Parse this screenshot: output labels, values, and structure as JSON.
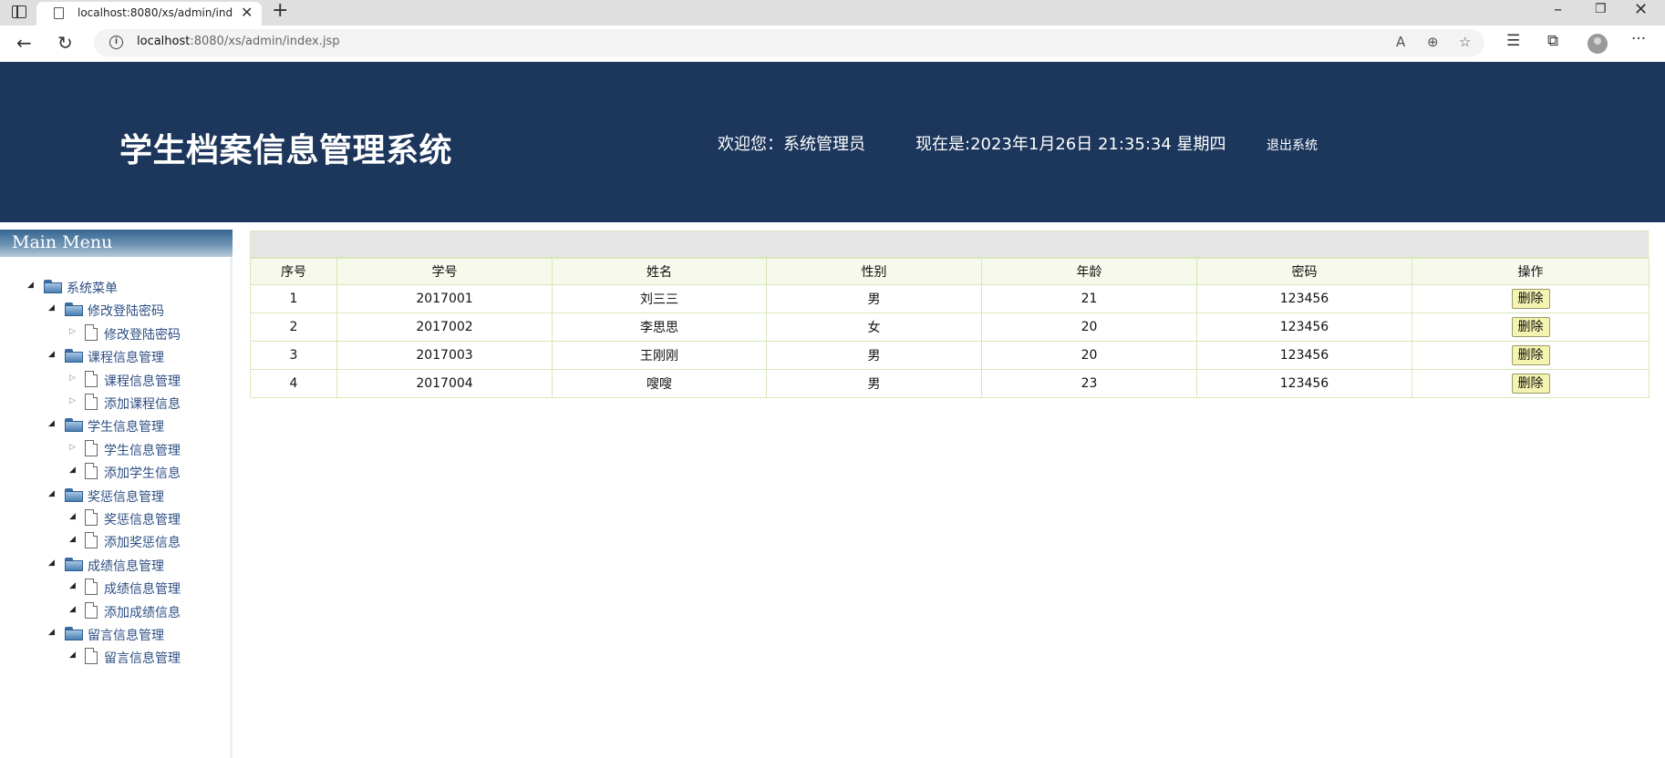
{
  "browser": {
    "tab_title": "localhost:8080/xs/admin/index.jsp",
    "url_host": "localhost",
    "url_rest": ":8080/xs/admin/index.jsp"
  },
  "header": {
    "title": "学生档案信息管理系统",
    "welcome": "欢迎您：系统管理员",
    "clock": "现在是:2023年1月26日 21:35:34 星期四",
    "logout": "退出系统",
    "background": "#1c365c"
  },
  "sidebar": {
    "title": "Main Menu",
    "items": [
      {
        "label": "系统菜单",
        "level": 0,
        "type": "folder",
        "arrow": "open"
      },
      {
        "label": "修改登陆密码",
        "level": 1,
        "type": "folder",
        "arrow": "open"
      },
      {
        "label": "修改登陆密码",
        "level": 2,
        "type": "file",
        "arrow": "closed"
      },
      {
        "label": "课程信息管理",
        "level": 1,
        "type": "folder",
        "arrow": "open"
      },
      {
        "label": "课程信息管理",
        "level": 2,
        "type": "file",
        "arrow": "closed"
      },
      {
        "label": "添加课程信息",
        "level": 2,
        "type": "file",
        "arrow": "closed"
      },
      {
        "label": "学生信息管理",
        "level": 1,
        "type": "folder",
        "arrow": "open"
      },
      {
        "label": "学生信息管理",
        "level": 2,
        "type": "file",
        "arrow": "closed"
      },
      {
        "label": "添加学生信息",
        "level": 2,
        "type": "file",
        "arrow": "open"
      },
      {
        "label": "奖惩信息管理",
        "level": 1,
        "type": "folder",
        "arrow": "open"
      },
      {
        "label": "奖惩信息管理",
        "level": 2,
        "type": "file",
        "arrow": "open"
      },
      {
        "label": "添加奖惩信息",
        "level": 2,
        "type": "file",
        "arrow": "open"
      },
      {
        "label": "成绩信息管理",
        "level": 1,
        "type": "folder",
        "arrow": "open"
      },
      {
        "label": "成绩信息管理",
        "level": 2,
        "type": "file",
        "arrow": "open"
      },
      {
        "label": "添加成绩信息",
        "level": 2,
        "type": "file",
        "arrow": "open"
      },
      {
        "label": "留言信息管理",
        "level": 1,
        "type": "folder",
        "arrow": "open"
      },
      {
        "label": "留言信息管理",
        "level": 2,
        "type": "file",
        "arrow": "open"
      }
    ]
  },
  "table": {
    "columns": [
      "序号",
      "学号",
      "姓名",
      "性别",
      "年龄",
      "密码",
      "操作"
    ],
    "rows": [
      [
        "1",
        "2017001",
        "刘三三",
        "男",
        "21",
        "123456"
      ],
      [
        "2",
        "2017002",
        "李思思",
        "女",
        "20",
        "123456"
      ],
      [
        "3",
        "2017003",
        "王刚刚",
        "男",
        "20",
        "123456"
      ],
      [
        "4",
        "2017004",
        "嗖嗖",
        "男",
        "23",
        "123456"
      ]
    ],
    "action_label": "删除"
  }
}
